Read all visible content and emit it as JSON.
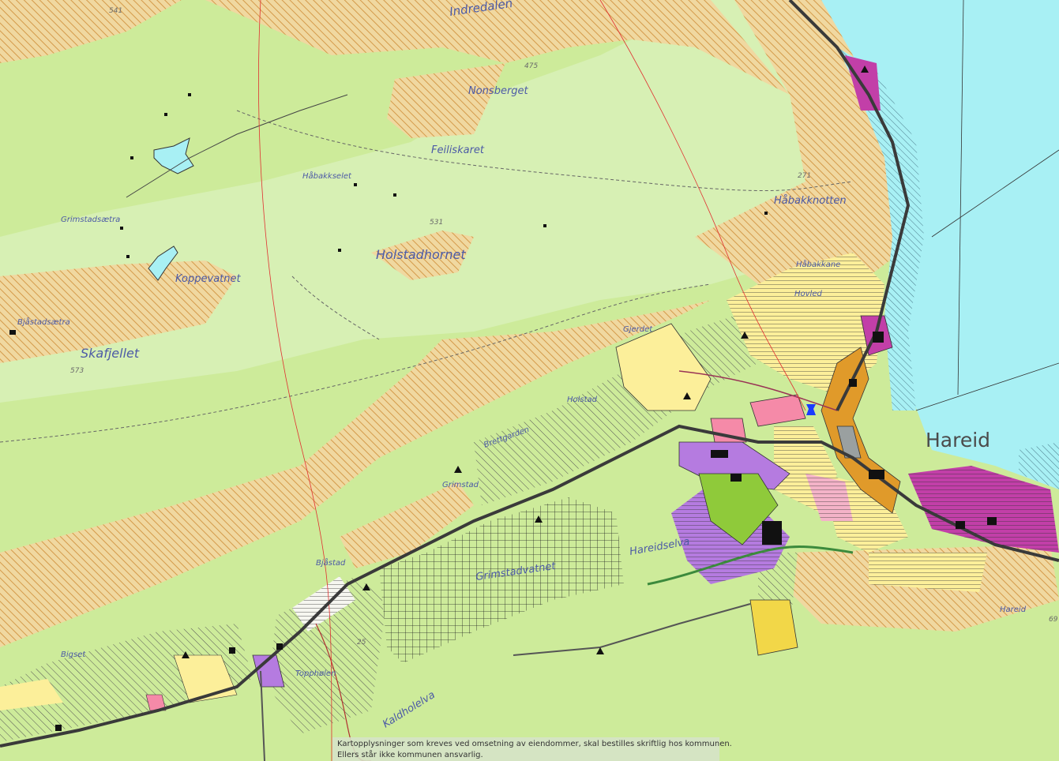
{
  "map": {
    "colors": {
      "background_green": "#cdeb9a",
      "light_green": "#d7f0b4",
      "hatch_orange": "#e8b570",
      "water": "#a8f0f4",
      "residential_yellow": "#fcef9a",
      "commercial_pink": "#f58aa8",
      "purple": "#b57be0",
      "magenta": "#c23fa8",
      "green_zone": "#8fca3a",
      "road": "#444444",
      "orange_center": "#e09a2a"
    },
    "place_labels": {
      "indredalen": "Indredalen",
      "nonsberget": "Nonsberget",
      "feiliskaret": "Feiliskaret",
      "habakkselet": "Håbakkselet",
      "grimstadsaetra": "Grimstadsætra",
      "holstadhornet": "Holstadhornet",
      "koppevatnet": "Koppevatnet",
      "bjastadsaetra": "Bjåstadsætra",
      "skafjellet": "Skafjellet",
      "habakknotten": "Håbakknotten",
      "habakkane": "Håbakkane",
      "hovled": "Hovled",
      "gjerdet": "Gjerdet",
      "holstad": "Holstad",
      "brettgarden": "Brettgarden",
      "grimstad": "Grimstad",
      "hareid": "Hareid",
      "hareidselva": "Hareidselva",
      "grimstadvatnet": "Grimstadvatnet",
      "bjastad": "Bjåstad",
      "bigset": "Bigset",
      "topphollen": "Topphølen",
      "kaldholelva": "Kaldholelva",
      "hareid_small": "Hareid"
    },
    "elevations": {
      "e541": "541",
      "e475": "475",
      "e531": "531",
      "e573": "573",
      "e271": "271",
      "e25": "25",
      "e69": "69"
    },
    "disclaimer": {
      "line1": "Kartopplysninger som kreves ved omsetning av eiendommer, skal bestilles skriftlig hos kommunen.",
      "line2": "Ellers står ikke kommunen ansvarlig."
    }
  }
}
